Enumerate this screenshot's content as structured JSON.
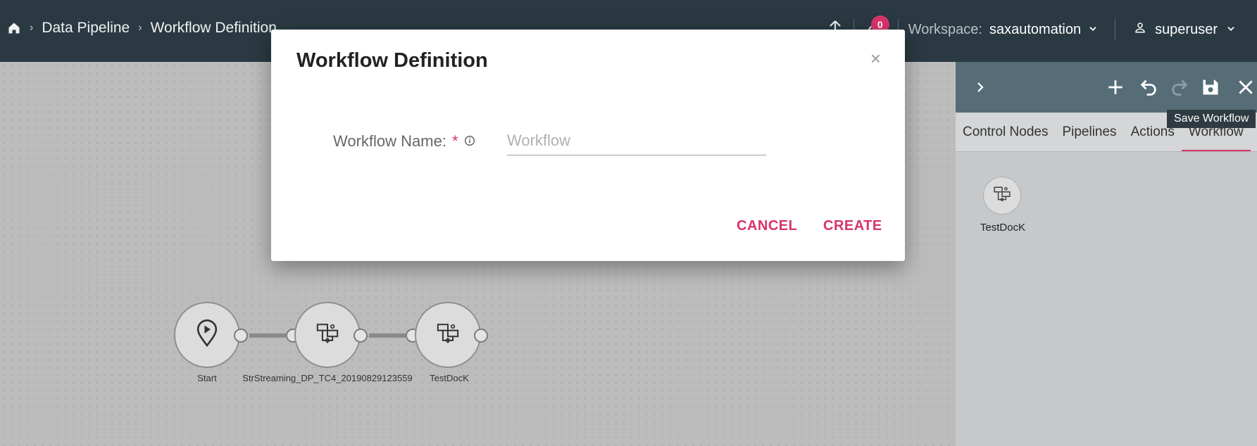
{
  "breadcrumb": {
    "items": [
      "Data Pipeline",
      "Workflow Definition"
    ]
  },
  "topbar": {
    "notification_count": "0",
    "workspace_label": "Workspace:",
    "workspace_value": "saxautomation",
    "user_name": "superuser"
  },
  "canvas": {
    "nodes": [
      {
        "label": "Start",
        "icon": "play-pin-icon"
      },
      {
        "label": "StrStreaming_DP_TC4_20190829123559",
        "icon": "workflow-icon"
      },
      {
        "label": "TestDocK",
        "icon": "workflow-icon"
      }
    ]
  },
  "panel": {
    "tabs": [
      "Control Nodes",
      "Pipelines",
      "Actions",
      "Workflow"
    ],
    "active_tab": "Workflow",
    "tooltip": "Save Workflow",
    "palette_items": [
      {
        "label": "TestDocK",
        "icon": "workflow-icon"
      }
    ]
  },
  "modal": {
    "title": "Workflow Definition",
    "close": "×",
    "field_label": "Workflow Name:",
    "required_mark": "*",
    "field_placeholder": "Workflow",
    "field_value": "",
    "cancel_label": "CANCEL",
    "create_label": "CREATE"
  },
  "colors": {
    "accent": "#d8336a",
    "topbar": "#2a3942",
    "panel_header": "#566d78"
  }
}
